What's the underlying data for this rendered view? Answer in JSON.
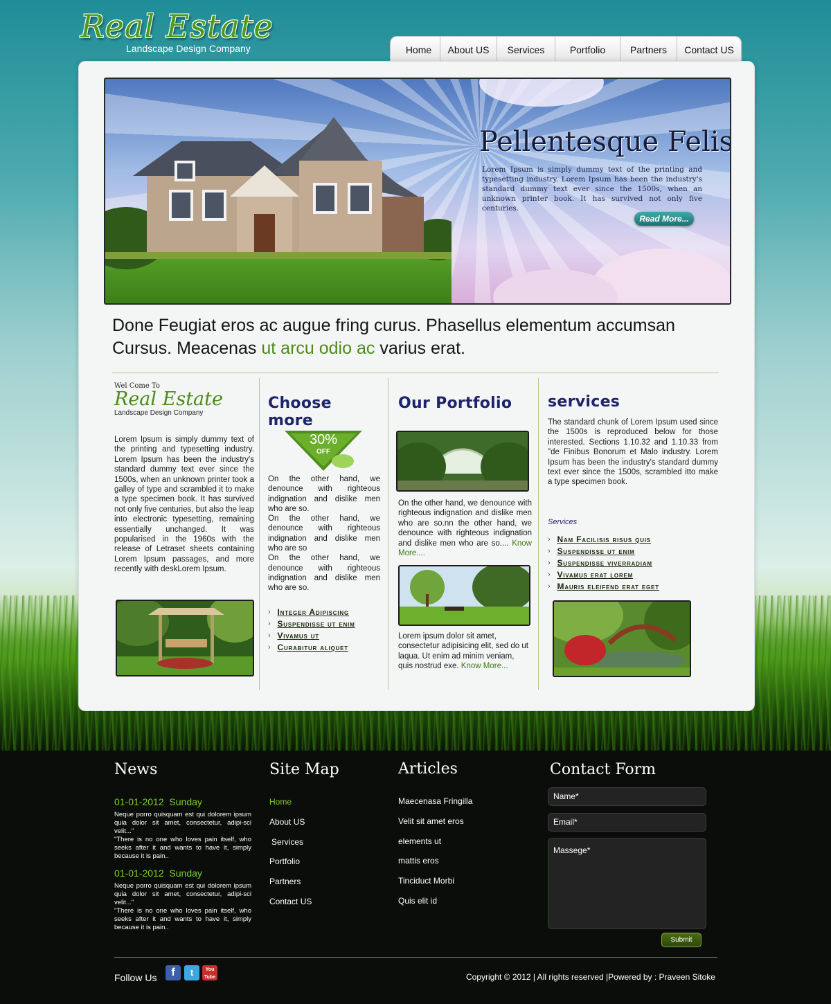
{
  "header": {
    "logo_title": "Real Estate",
    "logo_subtitle": "Landscape Design Company",
    "nav": [
      "Home",
      "About US",
      "Services",
      "Portfolio",
      "Partners",
      "Contact US"
    ]
  },
  "banner": {
    "title": "Pellentesque Felis",
    "text": "Lorem Ipsum is simply dummy text of the printing and typesetting industry. Lorem Ipsum has been the industry's standard dummy text ever since the 1500s, when an unknown printer book. It has survived not only five centuries.",
    "button": "Read More..."
  },
  "tagline": {
    "part1": "Done Feugiat eros ac augue fring curus. Phasellus elementum accumsan Cursus. Meacenas ",
    "highlight": "ut arcu odio ac",
    "part2": " varius erat."
  },
  "col1": {
    "welcome": "Wel Come To",
    "title": "Real Estate",
    "subtitle": "Landscape Design Company",
    "text": "Lorem Ipsum is simply dummy text of the printing and typesetting industry. Lorem Ipsum has been the industry's standard dummy text ever since the 1500s, when an unknown printer took a galley of type and scrambled it to make a type specimen book. It has survived not only five centuries, but also the leap into electronic typesetting, remaining essentially unchanged. It was popularised in the 1960s with the release of Letraset sheets containing Lorem Ipsum passages, and more recently with deskLorem Ipsum."
  },
  "col2": {
    "heading": "Choose more",
    "badge_percent": "30%",
    "badge_off": "OFF",
    "text": "On the other hand, we denounce with righteous indignation and dislike men who are so.\nOn the other hand, we denounce with righteous indignation and dislike men who are so\nOn the other hand, we denounce with righteous indignation and dislike men who are so.",
    "links": [
      "Integer Adipiscing",
      "Suspendisse ut enim",
      "Vivamus ut",
      "Curabitur aliquet"
    ]
  },
  "col3": {
    "heading": "Our Portfolio",
    "text1": "On the other hand, we denounce with righteous indignation and dislike men who are so.nn the other hand, we denounce with righteous indignation and dislike men who are so....",
    "know1": "Know More....",
    "text2": "Lorem ipsum dolor sit amet, consectetur adipisicing elit, sed do ut laqua. Ut enim ad minim veniam, quis nostrud exe.",
    "know2": "Know More..."
  },
  "col4": {
    "heading": "services",
    "text": "The standard chunk of Lorem Ipsum used since the 1500s is reproduced below for those interested. Sections 1.10.32 and 1.10.33 from \"de Finibus Bonorum et Malo industry. Lorem Ipsum has been the industry's standard dummy text ever since the 1500s, scrambled itto make a type specimen book.",
    "services_label": "Services",
    "links": [
      "Nam Facilisis risus quis",
      "Suspendisse ut enim",
      "Suspendisse viverradiam",
      "Vivamus erat lorem",
      "Mauris eleifend erat eget"
    ]
  },
  "footer": {
    "news_heading": "News",
    "news": [
      {
        "date": "01-01-2012",
        "day": "Sunday",
        "text": "Neque porro quisquam est qui dolorem ipsum quia dolor sit amet, consectetur, adipi-sci velit...\"",
        "quote": "\"There is no one who loves pain itself, who seeks after it and wants to have it, simply because it is pain.."
      },
      {
        "date": "01-01-2012",
        "day": "Sunday",
        "text": "Neque porro quisquam est qui dolorem ipsum quia dolor sit amet, consectetur, adipi-sci velit...\"",
        "quote": "\"There is no one who loves pain itself, who seeks after it and wants to have it, simply because it is pain.."
      }
    ],
    "sitemap_heading": "Site Map",
    "sitemap": [
      "Home",
      "About US",
      "Services",
      "Portfolio",
      "Partners",
      "Contact US"
    ],
    "articles_heading": "Articles",
    "articles": [
      "Maecenasa Fringilla",
      "Velit sit amet eros",
      "elements ut",
      "mattis eros",
      "Tinciduct Morbi",
      "Quis elit id"
    ],
    "contact_heading": "Contact Form",
    "name_placeholder": "Name*",
    "email_placeholder": "Email*",
    "message_placeholder": "Massege*",
    "submit": "Submit",
    "follow_us": "Follow Us",
    "social": [
      "facebook-icon",
      "twitter-icon",
      "youtube-icon"
    ],
    "copyright": "Copyright © 2012 | All rights reserved |Powered by : Praveen Sitoke"
  },
  "colors": {
    "accent_green": "#4a8a1a",
    "heading_navy": "#1e2469",
    "footer_green": "#7bd12a"
  }
}
